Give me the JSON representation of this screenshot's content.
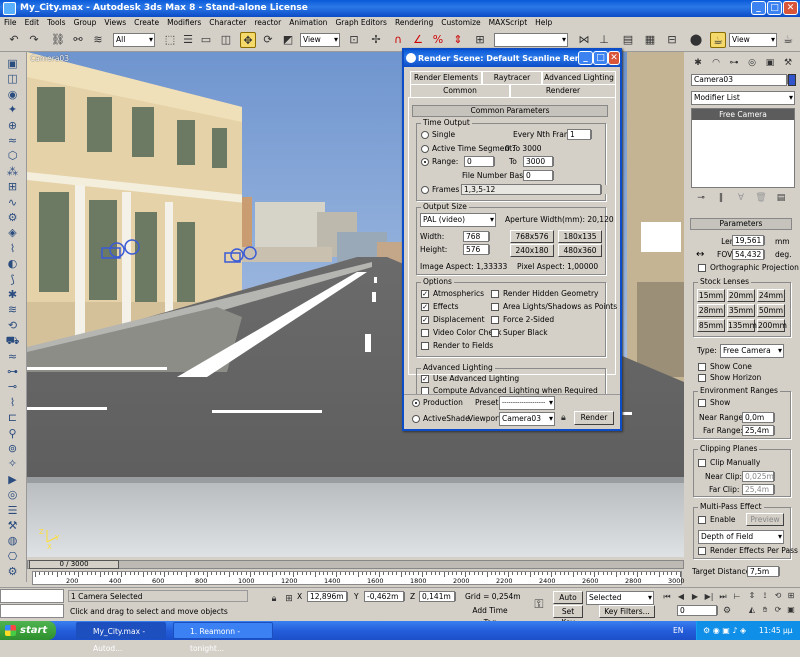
{
  "window": {
    "title": "My_City.max - Autodesk 3ds Max 8 - Stand-alone License",
    "min": "_",
    "max": "□",
    "close": "✕"
  },
  "menu": [
    "File",
    "Edit",
    "Tools",
    "Group",
    "Views",
    "Create",
    "Modifiers",
    "Character",
    "reactor",
    "Animation",
    "Graph Editors",
    "Rendering",
    "Customize",
    "MAXScript",
    "Help"
  ],
  "toolbar": {
    "selection_filter": "All",
    "ref_coord": "View",
    "named_sel": "",
    "view_dd": "View"
  },
  "viewport": {
    "label": "Camera03"
  },
  "dialog": {
    "title": "Render Scene: Default Scanline Rende...",
    "tabs_row1": [
      "Render Elements",
      "Raytracer",
      "Advanced Lighting"
    ],
    "tabs_row2": [
      "Common",
      "Renderer"
    ],
    "section": "Common Parameters",
    "time_output": {
      "label": "Time Output",
      "single": "Single",
      "every_nth": "Every Nth Frame:",
      "every_nth_val": "1",
      "active_segment": "Active Time Segment:",
      "active_segment_val": "0 To 3000",
      "range": "Range:",
      "range_from": "0",
      "to": "To",
      "range_to": "3000",
      "file_number_base": "File Number Base:",
      "file_number_val": "0",
      "frames": "Frames",
      "frames_val": "1,3,5-12"
    },
    "output_size": {
      "label": "Output Size",
      "preset": "PAL (video)",
      "aperture": "Aperture Width(mm): 20,120",
      "width_lbl": "Width:",
      "width": "768",
      "height_lbl": "Height:",
      "height": "576",
      "presets": [
        "768x576",
        "180x135",
        "240x180",
        "480x360"
      ],
      "image_aspect": "Image Aspect: 1,33333",
      "pixel_aspect": "Pixel Aspect: 1,00000"
    },
    "options": {
      "label": "Options",
      "items": [
        {
          "text": "Atmospherics",
          "checked": true
        },
        {
          "text": "Render Hidden Geometry",
          "checked": false
        },
        {
          "text": "Effects",
          "checked": true
        },
        {
          "text": "Area Lights/Shadows as Points",
          "checked": false
        },
        {
          "text": "Displacement",
          "checked": true
        },
        {
          "text": "Force 2-Sided",
          "checked": false
        },
        {
          "text": "Video Color Check",
          "checked": false
        },
        {
          "text": "Super Black",
          "checked": false
        },
        {
          "text": "Render to Fields",
          "checked": false
        }
      ]
    },
    "advanced_lighting": {
      "label": "Advanced Lighting",
      "use": "Use Advanced Lighting",
      "compute": "Compute Advanced Lighting when Required"
    },
    "bottom": {
      "production": "Production",
      "preset_lbl": "Preset:",
      "preset_val": "--------------------",
      "activeshade": "ActiveShade",
      "viewport_lbl": "Viewport:",
      "viewport_val": "Camera03",
      "render": "Render"
    }
  },
  "command_panel": {
    "object_name": "Camera03",
    "modifier_list": "Modifier List",
    "stack_item": "Free Camera",
    "parameters": "Parameters",
    "lens_lbl": "Lens:",
    "lens": "19,561",
    "lens_unit": "mm",
    "fov_lbl": "FOV:",
    "fov": "54,432",
    "fov_unit": "deg.",
    "ortho": "Orthographic Projection",
    "stock_lenses": "Stock Lenses",
    "lenses": [
      "15mm",
      "20mm",
      "24mm",
      "28mm",
      "35mm",
      "50mm",
      "85mm",
      "135mm",
      "200mm"
    ],
    "type_lbl": "Type:",
    "type": "Free Camera",
    "show_cone": "Show Cone",
    "show_horizon": "Show Horizon",
    "env_ranges": "Environment Ranges",
    "show": "Show",
    "near_range_lbl": "Near Range:",
    "near_range": "0,0m",
    "far_range_lbl": "Far Range:",
    "far_range": "25,4m",
    "clipping": "Clipping Planes",
    "clip_manually": "Clip Manually",
    "near_clip_lbl": "Near Clip:",
    "near_clip": "0,025m",
    "far_clip_lbl": "Far Clip:",
    "far_clip": "25,4m",
    "multipass": "Multi-Pass Effect",
    "enable": "Enable",
    "preview": "Preview",
    "dof": "Depth of Field",
    "render_effects": "Render Effects Per Pass",
    "target_distance_lbl": "Target Distance:",
    "target_distance": "7,5m"
  },
  "timeline": {
    "slider": "0 / 3000",
    "ticks": [
      "0",
      "200",
      "400",
      "600",
      "800",
      "1000",
      "1200",
      "1400",
      "1600",
      "1800",
      "2000",
      "2200",
      "2400",
      "2600",
      "2800",
      "3000"
    ]
  },
  "status": {
    "selection": "1 Camera Selected",
    "prompt": "Click and drag to select and move objects",
    "x_lbl": "X",
    "x": "12,896m",
    "y_lbl": "Y",
    "y": "-0,462m",
    "z_lbl": "Z",
    "z": "0,141m",
    "grid": "Grid = 0,254m",
    "add_time_tag": "Add Time Tag",
    "auto_key": "Auto Key",
    "set_key": "Set Key",
    "selected": "Selected",
    "key_filters": "Key Filters...",
    "frame": "0"
  },
  "taskbar": {
    "start": "start",
    "tasks": [
      "My_City.max - Autod...",
      "1. Reamonn - tonight..."
    ],
    "lang": "EN",
    "clock": "11:45 μμ"
  }
}
